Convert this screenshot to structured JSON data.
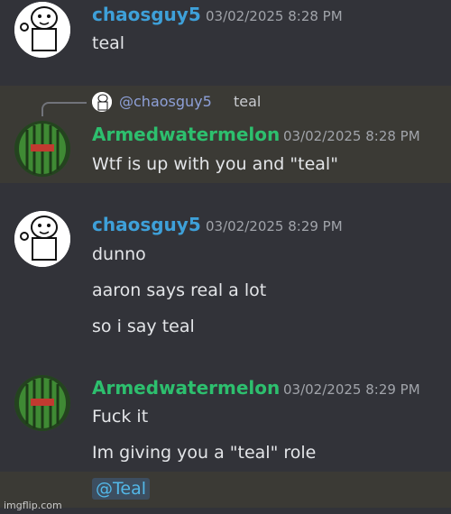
{
  "messages": [
    {
      "author": "chaosguy5",
      "timestamp": "03/02/2025 8:28 PM",
      "lines": [
        "teal"
      ]
    },
    {
      "reply": {
        "mention": "@chaosguy5",
        "text": "teal"
      },
      "author": "Armedwatermelon",
      "timestamp": "03/02/2025 8:28 PM",
      "lines": [
        "Wtf is up with you and \"teal\""
      ]
    },
    {
      "author": "chaosguy5",
      "timestamp": "03/02/2025 8:29 PM",
      "lines": [
        "dunno",
        "aaron says real a lot",
        "so i say teal"
      ]
    },
    {
      "author": "Armedwatermelon",
      "timestamp": "03/02/2025 8:29 PM",
      "lines": [
        "Fuck it",
        "Im giving you a \"teal\" role"
      ],
      "role_mention": "@Teal"
    }
  ],
  "watermark": "imgflip.com",
  "colors": {
    "background": "#323339",
    "highlight": "#3b3a35",
    "blue_name": "#3ea0d9",
    "green_name": "#2dbf6e",
    "role_mention": "#53b8e8"
  }
}
